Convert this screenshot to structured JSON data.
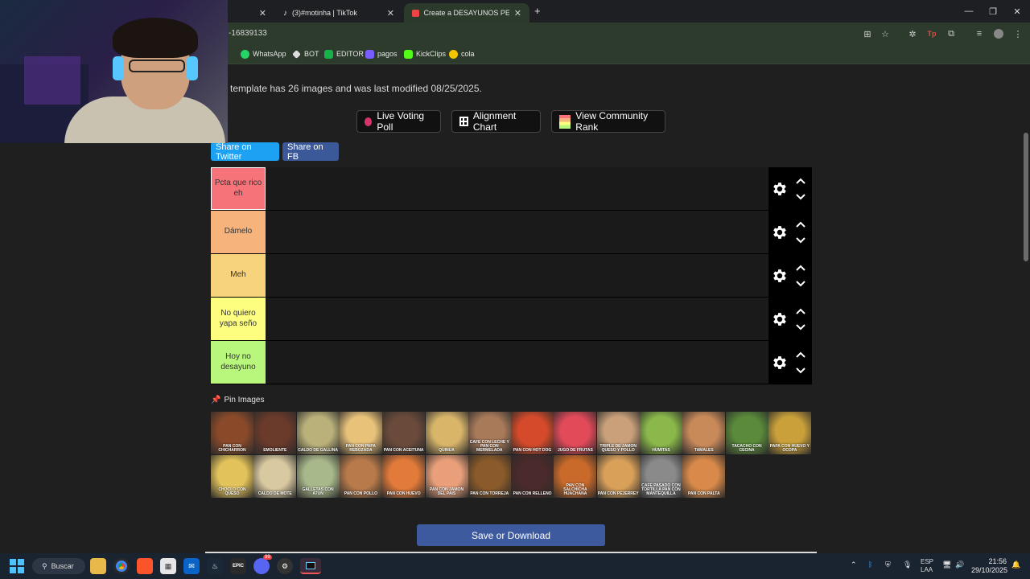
{
  "browser": {
    "tabs": [
      {
        "label": "",
        "active": false
      },
      {
        "label": "(3)#motinha | TikTok",
        "active": false
      },
      {
        "label": "Create a DESAYUNOS PERUANO",
        "active": true
      }
    ],
    "new_tab_symbol": "+",
    "url": "-16839133",
    "bookmarks": [
      {
        "label": "WhatsApp",
        "color": "#25d366"
      },
      {
        "label": "BOT",
        "color": "#dddddd"
      },
      {
        "label": "EDITOR",
        "color": "#17b14a"
      },
      {
        "label": "pagos",
        "color": "#7b5cff"
      },
      {
        "label": "KickClips",
        "color": "#53fc18"
      },
      {
        "label": "cola",
        "color": "#f5c400"
      }
    ]
  },
  "page": {
    "info_text": "template has 26 images and was last modified 08/25/2025.",
    "buttons": {
      "live_poll": "Live Voting Poll",
      "alignment": "Alignment Chart",
      "community": "View Community Rank",
      "share_twitter": "Share on Twitter",
      "share_fb": "Share on FB",
      "save": "Save or Download"
    },
    "tiers": [
      {
        "label": "Pcta que rico eh",
        "color": "#f6737a"
      },
      {
        "label": "Dámelo",
        "color": "#f7b37c"
      },
      {
        "label": "Meh",
        "color": "#f7d47c"
      },
      {
        "label": "No quiero yapa seño",
        "color": "#fdfd80"
      },
      {
        "label": "Hoy no desayuno",
        "color": "#b8f77c"
      }
    ],
    "pin_title": "Pin Images",
    "images": [
      {
        "caption": "PAN CON CHICHARRON",
        "color": "#8a4a2a"
      },
      {
        "caption": "EMOLIENTE",
        "color": "#6a3a2a"
      },
      {
        "caption": "CALDO DE GALLINA",
        "color": "#b9b07a"
      },
      {
        "caption": "PAN CON PAPA REBOZADA",
        "color": "#e9c27a"
      },
      {
        "caption": "PAN CON ACEITUNA",
        "color": "#6a4a3a"
      },
      {
        "caption": "QUINUA",
        "color": "#d9b56a"
      },
      {
        "caption": "CAFE CON LECHE Y PAN CON MERMELADA",
        "color": "#a87a5a"
      },
      {
        "caption": "PAN CON HOT DOG",
        "color": "#d44a2a"
      },
      {
        "caption": "JUGO DE FRUTAS",
        "color": "#e24a5a"
      },
      {
        "caption": "TRIPLE DE JAMON QUESO Y POLLO",
        "color": "#c9a07a"
      },
      {
        "caption": "HUMITAS",
        "color": "#8ab84a"
      },
      {
        "caption": "TAMALES",
        "color": "#c98a5a"
      },
      {
        "caption": "TACACHO CON CECINA",
        "color": "#5a8a3a"
      },
      {
        "caption": "PAPA CON HUEVO Y OCOPA",
        "color": "#c9a03a"
      },
      {
        "caption": "CHOCLO CON QUESO",
        "color": "#e2c25a"
      },
      {
        "caption": "CALDO DE MOTE",
        "color": "#d9c9a0"
      },
      {
        "caption": "GALLETAS CON ATUN",
        "color": "#a8b88a"
      },
      {
        "caption": "PAN CON POLLO",
        "color": "#b87a4a"
      },
      {
        "caption": "PAN CON HUEVO",
        "color": "#e27a3a"
      },
      {
        "caption": "PAN CON JAMON DEL PAIS",
        "color": "#e9a07a"
      },
      {
        "caption": "PAN CON TORREJA",
        "color": "#8a5a2a"
      },
      {
        "caption": "PAN CON RELLENO",
        "color": "#4a2a2a"
      },
      {
        "caption": "PAN CON SALCHICHA HUACHANA",
        "color": "#c96a2a"
      },
      {
        "caption": "PAN CON PEJERREY",
        "color": "#d9a05a"
      },
      {
        "caption": "CAFE PASADO CON TORTILLA PAN CON MANTEQUILLA",
        "color": "#8a8a8a"
      },
      {
        "caption": "PAN CON PALTA",
        "color": "#d98a4a"
      }
    ]
  },
  "taskbar": {
    "search": "Buscar",
    "discord_badge": "99",
    "lang": "ESP",
    "lang_sub": "LAA",
    "time": "21:56",
    "date": "29/10/2025"
  }
}
